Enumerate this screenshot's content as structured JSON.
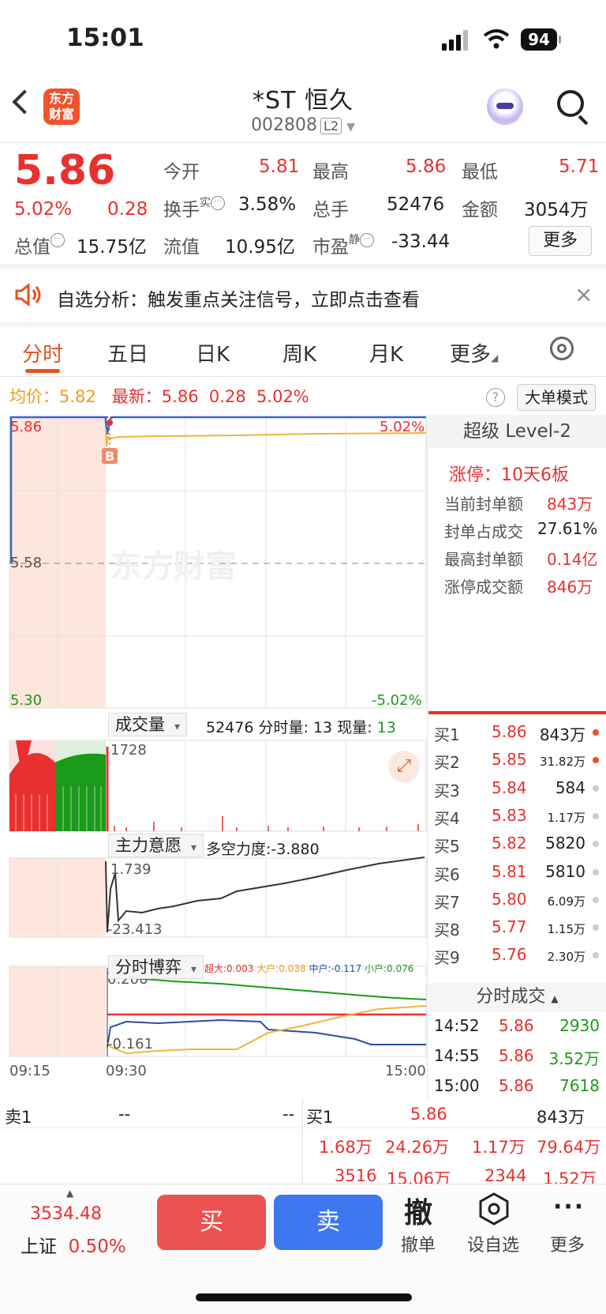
{
  "status": {
    "time": "15:01",
    "battery": "94"
  },
  "header": {
    "title": "*ST 恒久",
    "code": "002808",
    "level": "L2",
    "logo_text": "东方财富"
  },
  "quote": {
    "price": "5.86",
    "pct": "5.02%",
    "chg": "0.28",
    "rows": [
      [
        {
          "k": "今开",
          "v": "5.81",
          "c": "red"
        },
        {
          "k": "最高",
          "v": "5.86",
          "c": "red"
        },
        {
          "k": "最低",
          "v": "5.71",
          "c": "red"
        }
      ],
      [
        {
          "k": "换手",
          "v": "3.58%",
          "c": "dark"
        },
        {
          "k": "总手",
          "v": "52476",
          "c": "dark"
        },
        {
          "k": "金额",
          "v": "3054万",
          "c": "dark"
        }
      ],
      [
        {
          "k": "总值",
          "v": "15.75亿",
          "c": "dark"
        },
        {
          "k": "流值",
          "v": "10.95亿",
          "c": "dark"
        },
        {
          "k": "市盈",
          "v": "-33.44",
          "c": "dark"
        }
      ]
    ],
    "turnover_sup": "实",
    "pe_sup": "静",
    "more": "更多"
  },
  "banner": {
    "text": "自选分析：触发重点关注信号，立即点击查看",
    "close": "×"
  },
  "tabs": [
    "分时",
    "五日",
    "日K",
    "周K",
    "月K",
    "更多"
  ],
  "infoline": {
    "avg_label": "均价：",
    "avg": "5.82",
    "last_label": "最新：",
    "last": "5.86",
    "chg": "0.28",
    "pct": "5.02%",
    "mode": "大单模式"
  },
  "chart": {
    "y_high": "5.86",
    "y_mid": "5.58",
    "y_low": "5.30",
    "pct_high": "5.02%",
    "pct_low": "-5.02%",
    "b_marker": "B",
    "watermark": "东方财富"
  },
  "volume": {
    "selector": "成交量",
    "total": "52476",
    "minute_label": "分时量:",
    "minute": "13",
    "now_label": "现量:",
    "now": "13",
    "max": "1728"
  },
  "main_force": {
    "selector": "主力意愿",
    "label": "多空力度:",
    "value": "-3.880",
    "hi": "1.739",
    "lo": "-23.413"
  },
  "game": {
    "selector": "分时博弈",
    "super_label": "超大:",
    "super": "0.003",
    "big_label": "大户:",
    "big": "0.038",
    "mid_label": "中户:",
    "mid": "-0.117",
    "small_label": "小户:",
    "small": "0.076",
    "hi": "0.200",
    "lo": "-0.161"
  },
  "time_axis": [
    "09:15",
    "09:30",
    "15:00"
  ],
  "level2": {
    "title": "超级 Level-2",
    "limit": "涨停：10天6板",
    "rows": [
      {
        "k": "当前封单额",
        "v": "843万"
      },
      {
        "k": "封单占成交",
        "v": "27.61%"
      },
      {
        "k": "最高封单额",
        "v": "0.14亿"
      },
      {
        "k": "涨停成交额",
        "v": "846万"
      }
    ]
  },
  "orderbook": [
    {
      "name": "买1",
      "price": "5.86",
      "vol": "843万",
      "small": false,
      "dot": "#e8521f"
    },
    {
      "name": "买2",
      "price": "5.85",
      "vol": "31.82万",
      "small": true,
      "dot": "#e8521f"
    },
    {
      "name": "买3",
      "price": "5.84",
      "vol": "584",
      "small": false,
      "dot": "#ccc"
    },
    {
      "name": "买4",
      "price": "5.83",
      "vol": "1.17万",
      "small": true,
      "dot": "#ccc"
    },
    {
      "name": "买5",
      "price": "5.82",
      "vol": "5820",
      "small": false,
      "dot": "#ccc"
    },
    {
      "name": "买6",
      "price": "5.81",
      "vol": "5810",
      "small": false,
      "dot": "#ccc"
    },
    {
      "name": "买7",
      "price": "5.80",
      "vol": "6.09万",
      "small": true,
      "dot": "#ccc"
    },
    {
      "name": "买8",
      "price": "5.77",
      "vol": "1.15万",
      "small": true,
      "dot": "#ccc"
    },
    {
      "name": "买9",
      "price": "5.76",
      "vol": "2.30万",
      "small": true,
      "dot": "#ccc"
    }
  ],
  "ticks": {
    "title": "分时成交",
    "rows": [
      {
        "t": "14:52",
        "p": "5.86",
        "v": "2930"
      },
      {
        "t": "14:55",
        "p": "5.86",
        "v": "3.52万"
      },
      {
        "t": "15:00",
        "p": "5.86",
        "v": "7618"
      }
    ]
  },
  "bottom_book": {
    "sell1": "卖1",
    "sell1_a": "--",
    "sell1_b": "--",
    "buy1": "买1",
    "buy1_price": "5.86",
    "buy1_vol": "843万",
    "row2": [
      "1.68万",
      "24.26万",
      "1.17万",
      "79.64万"
    ],
    "row3": [
      "3516",
      "15.06万",
      "2344",
      "1.52万"
    ]
  },
  "bottombar": {
    "index_value": "3534.48",
    "index_name": "上证",
    "index_pct": "0.50%",
    "buy": "买",
    "sell": "卖",
    "cancel_icon": "撤",
    "cancel": "撤单",
    "watch": "设自选",
    "more": "更多"
  }
}
